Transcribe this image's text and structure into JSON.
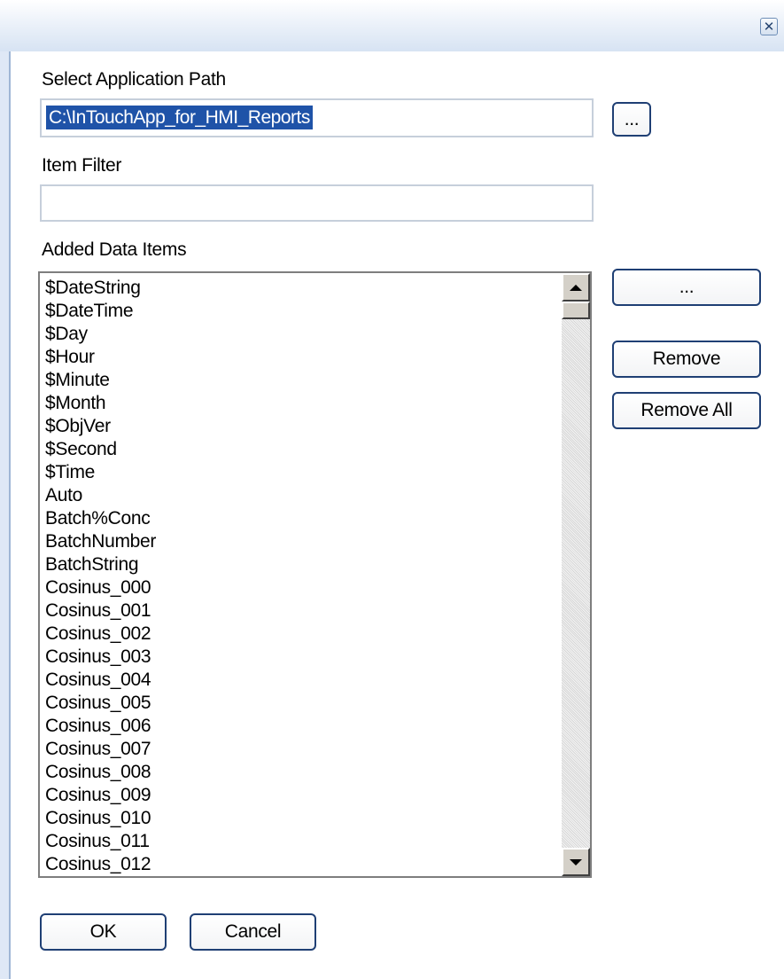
{
  "titlebar": {
    "close_icon": "close-icon",
    "close_glyph": "✕"
  },
  "app_path": {
    "label": "Select Application Path",
    "value": "C:\\InTouchApp_for_HMI_Reports",
    "browse_label": "..."
  },
  "filter": {
    "label": "Item Filter",
    "value": ""
  },
  "items": {
    "label": "Added Data Items",
    "list": [
      "$DateString",
      "$DateTime",
      "$Day",
      "$Hour",
      "$Minute",
      "$Month",
      "$ObjVer",
      "$Second",
      "$Time",
      "Auto",
      "Batch%Conc",
      "BatchNumber",
      "BatchString",
      "Cosinus_000",
      "Cosinus_001",
      "Cosinus_002",
      "Cosinus_003",
      "Cosinus_004",
      "Cosinus_005",
      "Cosinus_006",
      "Cosinus_007",
      "Cosinus_008",
      "Cosinus_009",
      "Cosinus_010",
      "Cosinus_011",
      "Cosinus_012"
    ],
    "add_label": "...",
    "remove_label": "Remove",
    "remove_all_label": "Remove All"
  },
  "footer": {
    "ok_label": "OK",
    "cancel_label": "Cancel"
  },
  "colors": {
    "selection": "#1f53a8",
    "button_border": "#1f3f74",
    "frame": "#dfe8f6"
  }
}
